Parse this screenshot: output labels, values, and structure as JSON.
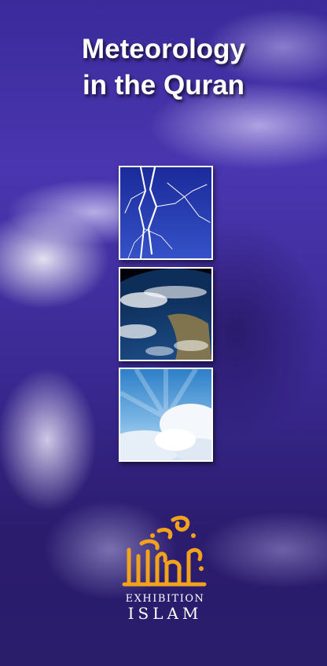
{
  "cover": {
    "title_line1": "Meteorology",
    "title_line2": "in the Quran"
  },
  "images": [
    {
      "name": "lightning-photo",
      "subject": "lightning bolts in dark blue sky"
    },
    {
      "name": "earth-photo",
      "subject": "planet Earth seen from space with clouds"
    },
    {
      "name": "clouds-photo",
      "subject": "sunlight rays behind white clouds"
    }
  ],
  "brand": {
    "logo_icon": "arabic-calligraphy-logo",
    "line1": "EXHIBITION",
    "line2": "ISLAM",
    "logo_color": "#f3a21c"
  }
}
